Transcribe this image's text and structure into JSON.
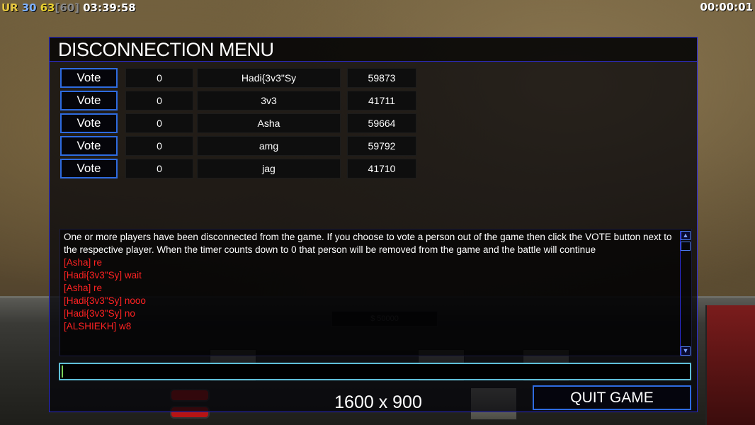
{
  "hud": {
    "ur_label": "UR",
    "ur_value": "30",
    "fps": "63",
    "fps_cap": "[60]",
    "clock": "03:39:58",
    "game_timer": "00:00:01"
  },
  "colors": {
    "accent_border": "#2e6be0",
    "chat_message": "#ff2222",
    "input_border": "#5fbfd8"
  },
  "dialog": {
    "title": "DISCONNECTION MENU",
    "players": [
      {
        "vote_label": "Vote",
        "timer": "0",
        "name": "Hadi{3v3\"Sy",
        "id": "59873"
      },
      {
        "vote_label": "Vote",
        "timer": "0",
        "name": "3v3",
        "id": "41711"
      },
      {
        "vote_label": "Vote",
        "timer": "0",
        "name": "Asha",
        "id": "59664"
      },
      {
        "vote_label": "Vote",
        "timer": "0",
        "name": "amg",
        "id": "59792"
      },
      {
        "vote_label": "Vote",
        "timer": "0",
        "name": "jag",
        "id": "41710"
      }
    ],
    "chat": {
      "notice": "One or more players have been disconnected from the game. If you choose to vote a person out of the game then click the VOTE button next to the respective player. When the timer counts down to 0 that person will be removed from the game and the battle will continue",
      "messages": [
        "[Asha] re",
        "[Hadi{3v3\"Sy] wait",
        "[Asha] re",
        "[Hadi{3v3\"Sy] nooo",
        "[Hadi{3v3\"Sy] no",
        "[ALSHIEKH] w8"
      ]
    },
    "input_value": "",
    "resolution_text": "1600 x 900",
    "quit_label": "QUIT GAME"
  }
}
